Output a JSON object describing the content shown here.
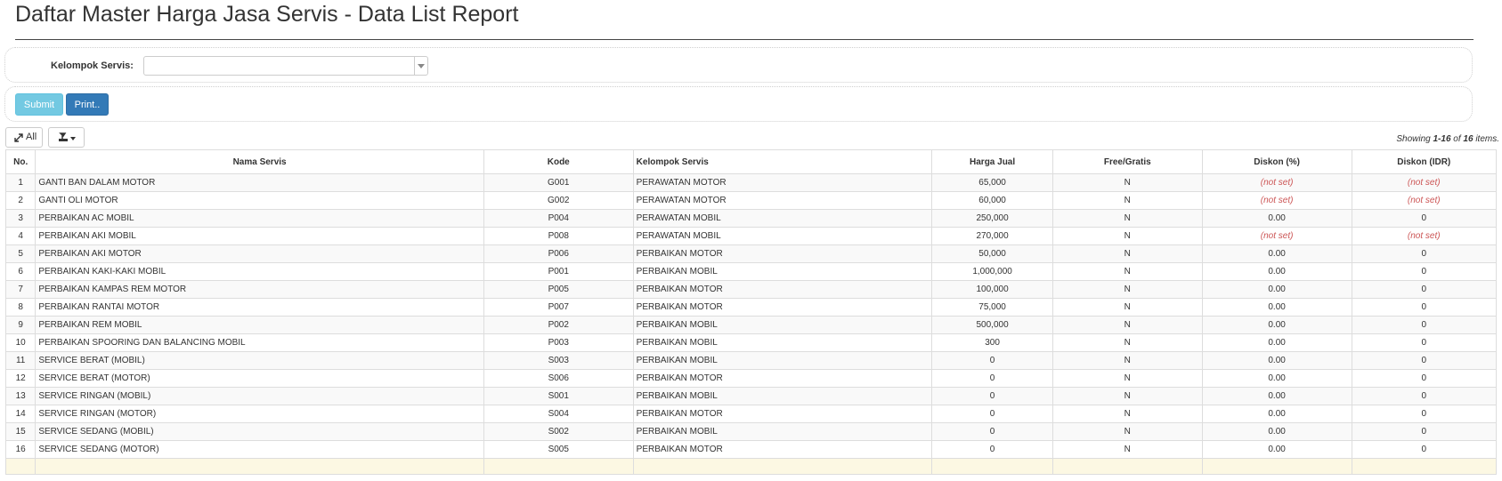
{
  "page": {
    "title": "Daftar Master Harga Jasa Servis - Data List Report"
  },
  "filter": {
    "label": "Kelompok Servis:",
    "value": ""
  },
  "actions": {
    "submit": "Submit",
    "print": "Print.."
  },
  "toolbar": {
    "all": "All",
    "icons": {
      "all": "expand-icon",
      "export": "export-icon"
    }
  },
  "summary": {
    "prefix": "Showing ",
    "range": "1-16",
    "mid": " of ",
    "total": "16",
    "suffix": " items."
  },
  "table": {
    "headers": [
      "No.",
      "Nama Servis",
      "Kode",
      "Kelompok Servis",
      "Harga Jual",
      "Free/Gratis",
      "Diskon (%)",
      "Diskon (IDR)"
    ],
    "rows": [
      [
        "1",
        "GANTI BAN DALAM MOTOR",
        "G001",
        "PERAWATAN MOTOR",
        "65,000",
        "N",
        "(not set)",
        "(not set)"
      ],
      [
        "2",
        "GANTI OLI MOTOR",
        "G002",
        "PERAWATAN MOTOR",
        "60,000",
        "N",
        "(not set)",
        "(not set)"
      ],
      [
        "3",
        "PERBAIKAN AC MOBIL",
        "P004",
        "PERAWATAN MOBIL",
        "250,000",
        "N",
        "0.00",
        "0"
      ],
      [
        "4",
        "PERBAIKAN AKI MOBIL",
        "P008",
        "PERAWATAN MOBIL",
        "270,000",
        "N",
        "(not set)",
        "(not set)"
      ],
      [
        "5",
        "PERBAIKAN AKI MOTOR",
        "P006",
        "PERBAIKAN MOTOR",
        "50,000",
        "N",
        "0.00",
        "0"
      ],
      [
        "6",
        "PERBAIKAN KAKI-KAKI MOBIL",
        "P001",
        "PERBAIKAN MOBIL",
        "1,000,000",
        "N",
        "0.00",
        "0"
      ],
      [
        "7",
        "PERBAIKAN KAMPAS REM MOTOR",
        "P005",
        "PERBAIKAN MOTOR",
        "100,000",
        "N",
        "0.00",
        "0"
      ],
      [
        "8",
        "PERBAIKAN RANTAI MOTOR",
        "P007",
        "PERBAIKAN MOTOR",
        "75,000",
        "N",
        "0.00",
        "0"
      ],
      [
        "9",
        "PERBAIKAN REM MOBIL",
        "P002",
        "PERBAIKAN MOBIL",
        "500,000",
        "N",
        "0.00",
        "0"
      ],
      [
        "10",
        "PERBAIKAN SPOORING DAN BALANCING MOBIL",
        "P003",
        "PERBAIKAN MOBIL",
        "300",
        "N",
        "0.00",
        "0"
      ],
      [
        "11",
        "SERVICE BERAT (MOBIL)",
        "S003",
        "PERBAIKAN MOBIL",
        "0",
        "N",
        "0.00",
        "0"
      ],
      [
        "12",
        "SERVICE BERAT (MOTOR)",
        "S006",
        "PERBAIKAN MOTOR",
        "0",
        "N",
        "0.00",
        "0"
      ],
      [
        "13",
        "SERVICE RINGAN (MOBIL)",
        "S001",
        "PERBAIKAN MOBIL",
        "0",
        "N",
        "0.00",
        "0"
      ],
      [
        "14",
        "SERVICE RINGAN (MOTOR)",
        "S004",
        "PERBAIKAN MOTOR",
        "0",
        "N",
        "0.00",
        "0"
      ],
      [
        "15",
        "SERVICE SEDANG (MOBIL)",
        "S002",
        "PERBAIKAN MOBIL",
        "0",
        "N",
        "0.00",
        "0"
      ],
      [
        "16",
        "SERVICE SEDANG (MOTOR)",
        "S005",
        "PERBAIKAN MOTOR",
        "0",
        "N",
        "0.00",
        "0"
      ]
    ]
  }
}
